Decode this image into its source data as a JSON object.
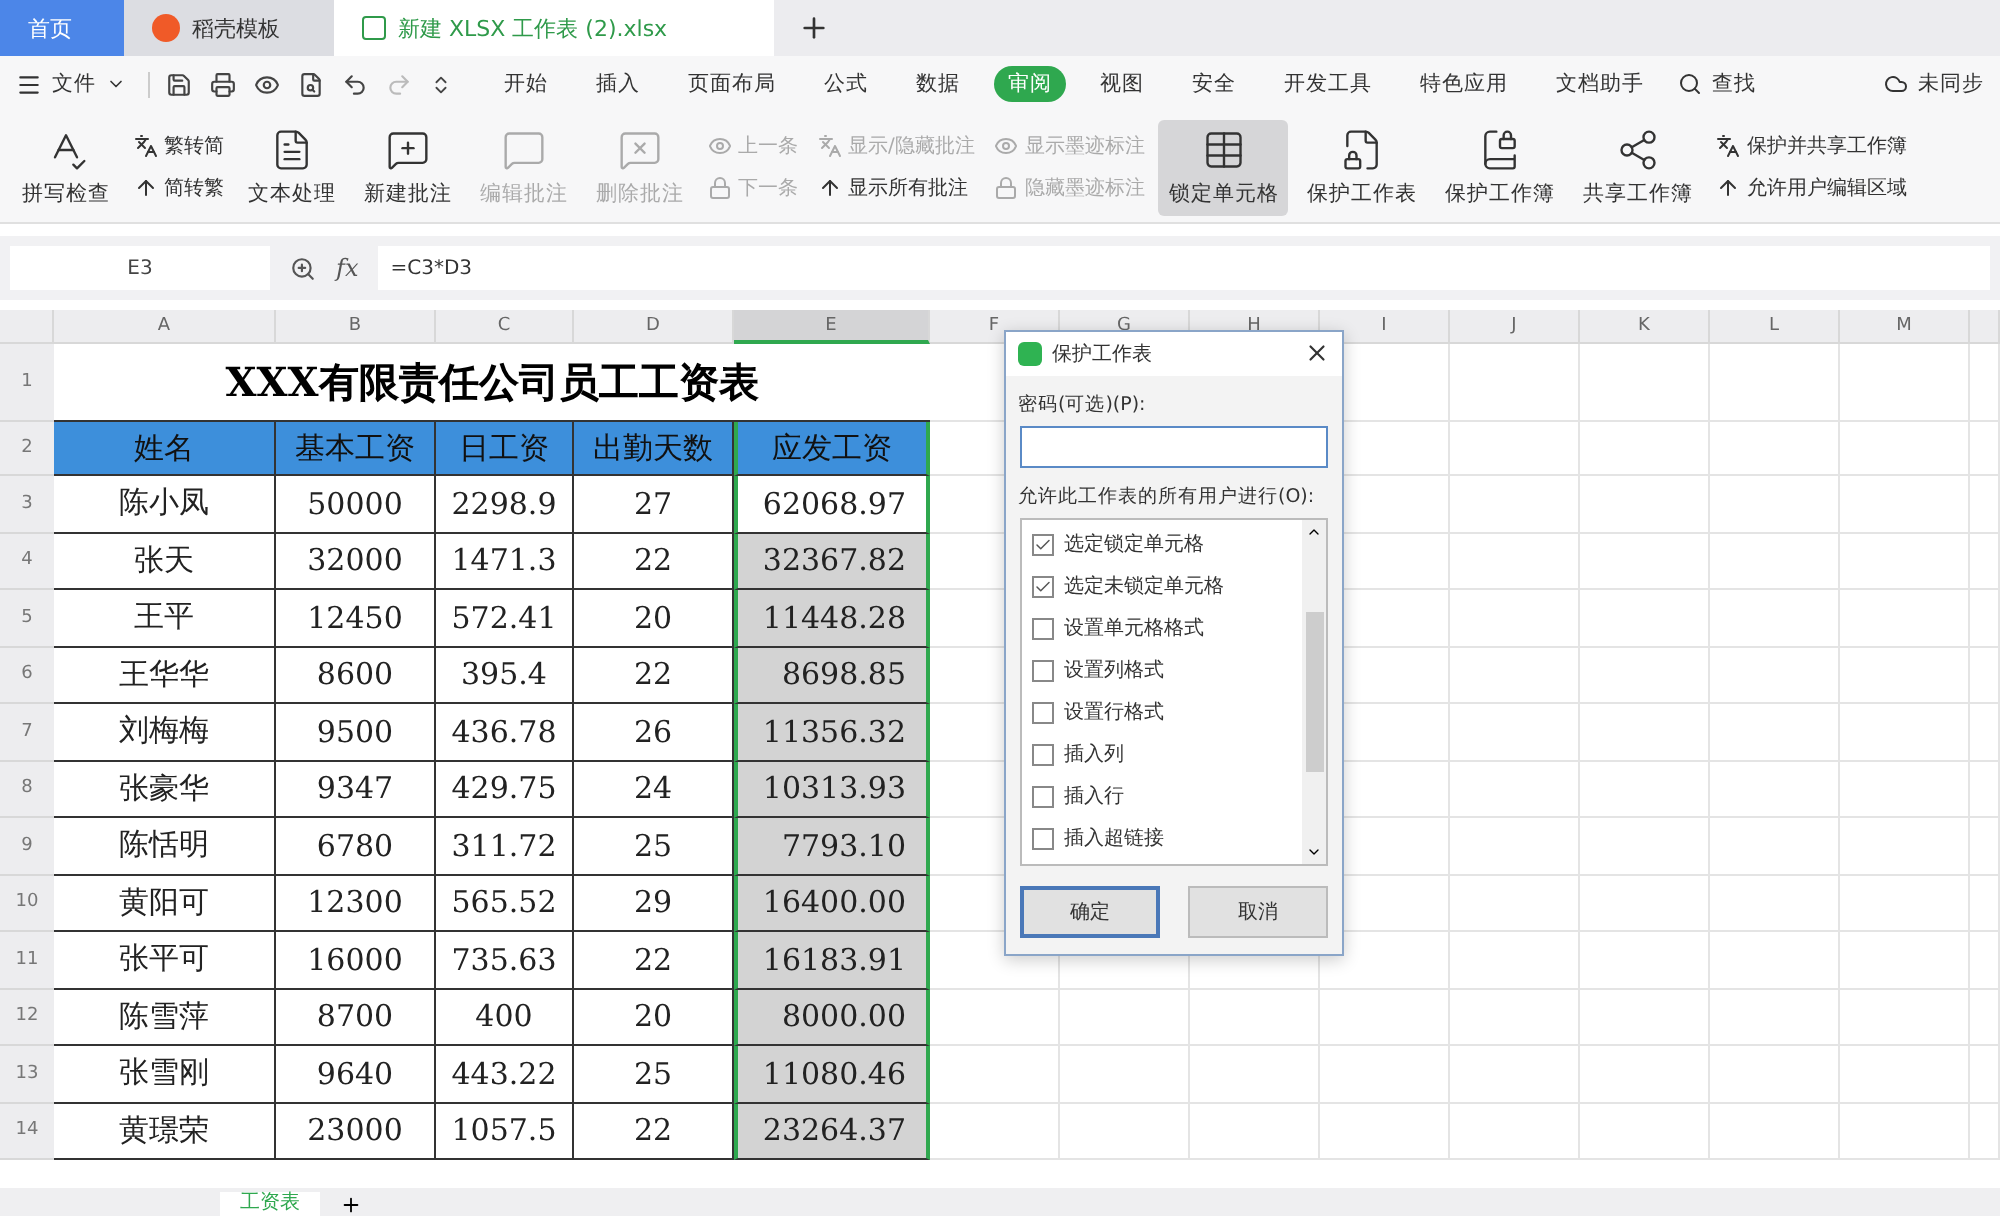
{
  "tabs": [
    {
      "label": "首页",
      "selected": false,
      "kind": "home"
    },
    {
      "label": "稻壳模板",
      "selected": false,
      "kind": "docer"
    },
    {
      "label": "新建 XLSX 工作表 (2).xlsx",
      "selected": true,
      "kind": "file"
    }
  ],
  "menu": {
    "file": "文件",
    "items": [
      {
        "label": "开始",
        "selected": false
      },
      {
        "label": "插入",
        "selected": false
      },
      {
        "label": "页面布局",
        "selected": false
      },
      {
        "label": "公式",
        "selected": false
      },
      {
        "label": "数据",
        "selected": false
      },
      {
        "label": "审阅",
        "selected": true
      },
      {
        "label": "视图",
        "selected": false
      },
      {
        "label": "安全",
        "selected": false
      },
      {
        "label": "开发工具",
        "selected": false
      },
      {
        "label": "特色应用",
        "selected": false
      },
      {
        "label": "文档助手",
        "selected": false
      }
    ],
    "search": "查找",
    "sync": "未同步"
  },
  "ribbon": [
    {
      "kind": "large",
      "label": "拼写检查",
      "disabled": false,
      "selected": false
    },
    {
      "kind": "stack",
      "items": [
        {
          "label": "繁转简",
          "disabled": false
        },
        {
          "label": "简转繁",
          "disabled": false
        }
      ]
    },
    {
      "kind": "large",
      "label": "文本处理",
      "disabled": false,
      "selected": false
    },
    {
      "kind": "large",
      "label": "新建批注",
      "disabled": false,
      "selected": false
    },
    {
      "kind": "large",
      "label": "编辑批注",
      "disabled": true,
      "selected": false
    },
    {
      "kind": "large",
      "label": "删除批注",
      "disabled": true,
      "selected": false
    },
    {
      "kind": "stack",
      "items": [
        {
          "label": "上一条",
          "disabled": true
        },
        {
          "label": "下一条",
          "disabled": true
        }
      ]
    },
    {
      "kind": "stack",
      "items": [
        {
          "label": "显示/隐藏批注",
          "disabled": true
        },
        {
          "label": "显示所有批注",
          "disabled": false
        }
      ]
    },
    {
      "kind": "stack",
      "items": [
        {
          "label": "显示墨迹标注",
          "disabled": true
        },
        {
          "label": "隐藏墨迹标注",
          "disabled": true
        }
      ]
    },
    {
      "kind": "large",
      "label": "锁定单元格",
      "disabled": false,
      "selected": true
    },
    {
      "kind": "large",
      "label": "保护工作表",
      "disabled": false,
      "selected": false
    },
    {
      "kind": "large",
      "label": "保护工作簿",
      "disabled": false,
      "selected": false
    },
    {
      "kind": "large",
      "label": "共享工作簿",
      "disabled": false,
      "selected": false
    },
    {
      "kind": "stack",
      "items": [
        {
          "label": "保护并共享工作簿",
          "disabled": false
        },
        {
          "label": "允许用户编辑区域",
          "disabled": false
        }
      ]
    }
  ],
  "formula_bar": {
    "name_box": "E3",
    "fx_label": "fx",
    "formula": "=C3*D3"
  },
  "sheet": {
    "columns": [
      {
        "label": "A",
        "selected": false
      },
      {
        "label": "B",
        "selected": false
      },
      {
        "label": "C",
        "selected": false
      },
      {
        "label": "D",
        "selected": false
      },
      {
        "label": "E",
        "selected": true
      },
      {
        "label": "F",
        "selected": false
      },
      {
        "label": "G",
        "selected": false
      },
      {
        "label": "H",
        "selected": false
      },
      {
        "label": "I",
        "selected": false
      },
      {
        "label": "J",
        "selected": false
      },
      {
        "label": "K",
        "selected": false
      },
      {
        "label": "L",
        "selected": false
      },
      {
        "label": "M",
        "selected": false
      }
    ],
    "title_row": "1",
    "title": "XXX有限责任公司员工工资表",
    "header_row": "2",
    "header": [
      "姓名",
      "基本工资",
      "日工资",
      "出勤天数",
      "应发工资"
    ],
    "rows": [
      {
        "number": "3",
        "cells": [
          "陈小凤",
          "50000",
          "2298.9",
          "27",
          "62068.97"
        ]
      },
      {
        "number": "4",
        "cells": [
          "张天",
          "32000",
          "1471.3",
          "22",
          "32367.82"
        ]
      },
      {
        "number": "5",
        "cells": [
          "王平",
          "12450",
          "572.41",
          "20",
          "11448.28"
        ]
      },
      {
        "number": "6",
        "cells": [
          "王华华",
          "8600",
          "395.4",
          "22",
          "8698.85"
        ]
      },
      {
        "number": "7",
        "cells": [
          "刘梅梅",
          "9500",
          "436.78",
          "26",
          "11356.32"
        ]
      },
      {
        "number": "8",
        "cells": [
          "张豪华",
          "9347",
          "429.75",
          "24",
          "10313.93"
        ]
      },
      {
        "number": "9",
        "cells": [
          "陈恬明",
          "6780",
          "311.72",
          "25",
          "7793.10"
        ]
      },
      {
        "number": "10",
        "cells": [
          "黄阳可",
          "12300",
          "565.52",
          "29",
          "16400.00"
        ]
      },
      {
        "number": "11",
        "cells": [
          "张平可",
          "16000",
          "735.63",
          "22",
          "16183.91"
        ]
      },
      {
        "number": "12",
        "cells": [
          "陈雪萍",
          "8700",
          "400",
          "20",
          "8000.00"
        ]
      },
      {
        "number": "13",
        "cells": [
          "张雪刚",
          "9640",
          "443.22",
          "25",
          "11080.46"
        ]
      },
      {
        "number": "14",
        "cells": [
          "黄璟荣",
          "23000",
          "1057.5",
          "22",
          "23264.37"
        ]
      }
    ]
  },
  "sheet_tabs": [
    {
      "label": "工资表",
      "selected": true
    }
  ],
  "dialog": {
    "title": "保护工作表",
    "password_label": "密码(可选)(P):",
    "list_label": "允许此工作表的所有用户进行(O):",
    "options": [
      {
        "label": "选定锁定单元格",
        "checked": true
      },
      {
        "label": "选定未锁定单元格",
        "checked": true
      },
      {
        "label": "设置单元格格式",
        "checked": false
      },
      {
        "label": "设置列格式",
        "checked": false
      },
      {
        "label": "设置行格式",
        "checked": false
      },
      {
        "label": "插入列",
        "checked": false
      },
      {
        "label": "插入行",
        "checked": false
      },
      {
        "label": "插入超链接",
        "checked": false
      }
    ],
    "buttons": [
      {
        "label": "确定",
        "default": true
      },
      {
        "label": "取消",
        "default": false
      }
    ]
  }
}
